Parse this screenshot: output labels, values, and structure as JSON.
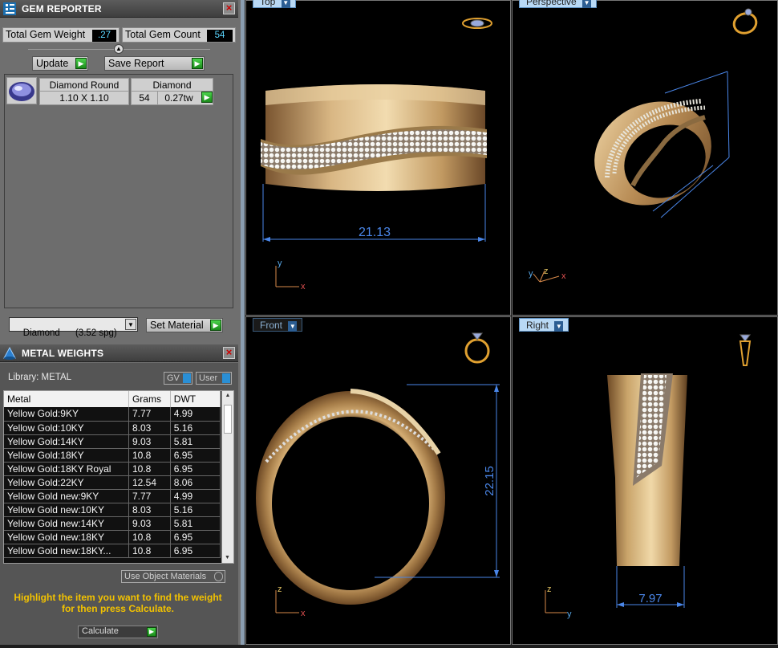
{
  "gem_reporter": {
    "title": "GEM REPORTER",
    "total_weight_label": "Total Gem Weight",
    "total_weight_value": ".27",
    "total_count_label": "Total Gem Count",
    "total_count_value": "54",
    "update_label": "Update",
    "save_report_label": "Save Report",
    "gem_rows": [
      {
        "shape": "Diamond Round",
        "size": "1.10 X 1.10",
        "material": "Diamond",
        "count": "54",
        "weight": "0.27tw"
      }
    ],
    "material_select": "Diamond      (3.52 spg)",
    "set_material_label": "Set Material"
  },
  "metal_weights": {
    "title": "METAL WEIGHTS",
    "library_label": "Library: METAL",
    "gv_label": "GV",
    "user_label": "User",
    "columns": [
      "Metal",
      "Grams",
      "DWT"
    ],
    "rows": [
      [
        "Yellow Gold:9KY",
        "7.77",
        "4.99"
      ],
      [
        "Yellow Gold:10KY",
        "8.03",
        "5.16"
      ],
      [
        "Yellow Gold:14KY",
        "9.03",
        "5.81"
      ],
      [
        "Yellow Gold:18KY",
        "10.8",
        "6.95"
      ],
      [
        "Yellow Gold:18KY Royal",
        "10.8",
        "6.95"
      ],
      [
        "Yellow Gold:22KY",
        "12.54",
        "8.06"
      ],
      [
        "Yellow Gold new:9KY",
        "7.77",
        "4.99"
      ],
      [
        "Yellow Gold new:10KY",
        "8.03",
        "5.16"
      ],
      [
        "Yellow Gold new:14KY",
        "9.03",
        "5.81"
      ],
      [
        "Yellow Gold new:18KY",
        "10.8",
        "6.95"
      ],
      [
        "Yellow Gold new:18KY...",
        "10.8",
        "6.95"
      ]
    ],
    "use_object_materials_label": "Use Object Materials",
    "hint": "Highlight the item you want to find the weight for then press Calculate.",
    "calculate_label": "Calculate"
  },
  "viewports": {
    "top": {
      "label": "Top",
      "dimension": "21.13",
      "axis1": "y",
      "axis2": "x"
    },
    "perspective": {
      "label": "Perspective",
      "axis1": "y",
      "axis2": "z",
      "axis3": "x"
    },
    "front": {
      "label": "Front",
      "dimension": "22.15",
      "axis1": "z",
      "axis2": "x"
    },
    "right": {
      "label": "Right",
      "dimension": "7.97",
      "axis1": "z",
      "axis2": "y"
    }
  },
  "colors": {
    "gold": "#c9a46a",
    "dimension_blue": "#4a86e8",
    "hint_yellow": "#f2c200",
    "active_tab": "#b9d9f5"
  }
}
